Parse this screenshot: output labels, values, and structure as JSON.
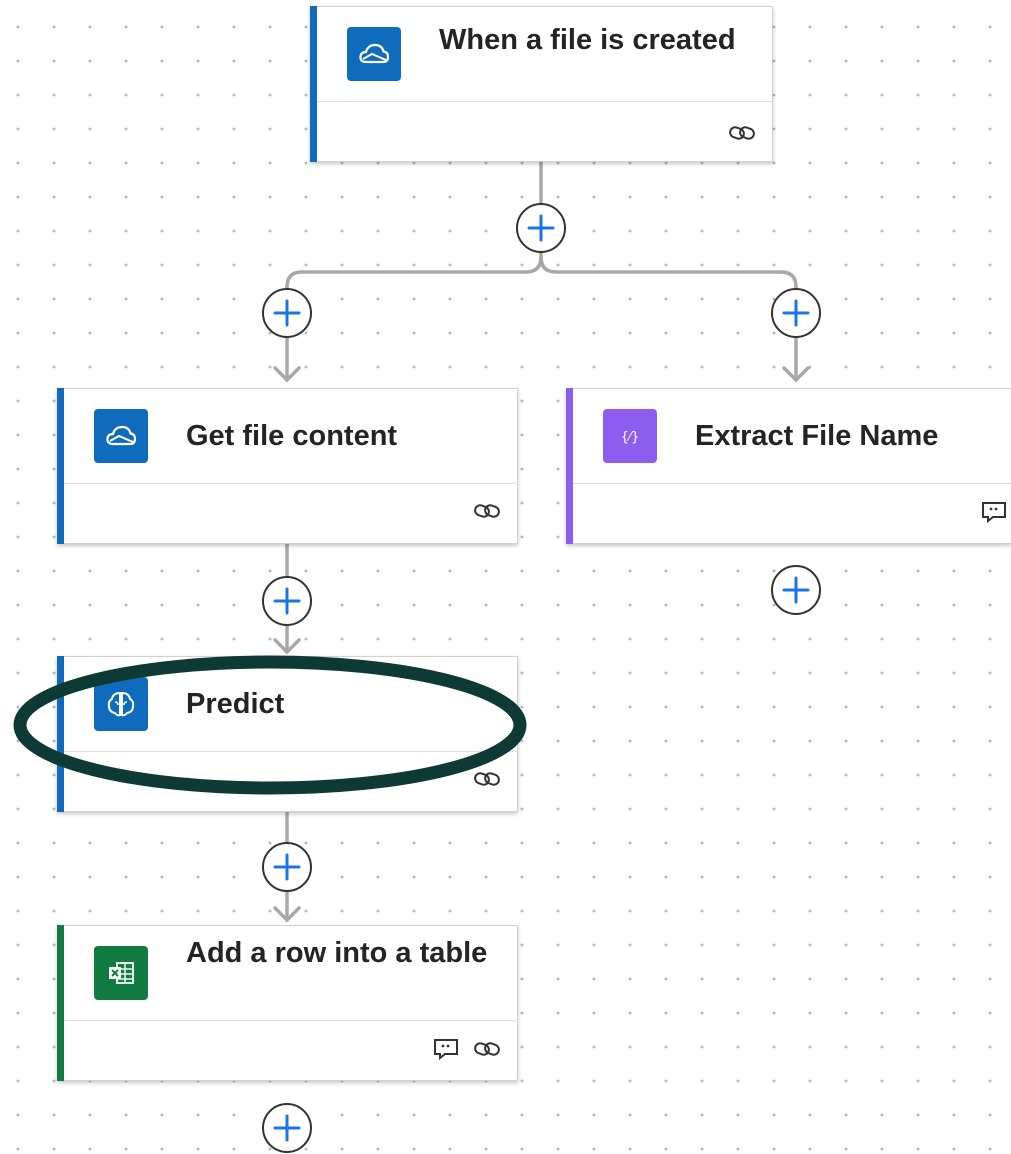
{
  "colors": {
    "onedrive_accent": "#0f6cbd",
    "data_operation_accent": "#8f5cf0",
    "ai_builder_accent": "#0f6cbd",
    "excel_accent": "#107c41",
    "plus_icon": "#1a73e8",
    "connector_line": "#a8a8a8",
    "highlight_ellipse": "#0e3a36"
  },
  "flow": {
    "trigger": {
      "title": "When a file is created",
      "icon": "onedrive-cloud-icon",
      "footer_icons": [
        "link-icon"
      ]
    },
    "steps": [
      {
        "title": "Get file content",
        "icon": "onedrive-cloud-icon",
        "footer_icons": [
          "link-icon"
        ]
      },
      {
        "title": "Extract File Name",
        "icon": "data-operation-icon",
        "footer_icons": [
          "comment-icon"
        ]
      },
      {
        "title": "Predict",
        "icon": "ai-builder-brain-icon",
        "footer_icons": [
          "link-icon"
        ],
        "highlighted": true
      },
      {
        "title": "Add a row into a table",
        "icon": "excel-icon",
        "footer_icons": [
          "comment-icon",
          "link-icon"
        ]
      }
    ]
  }
}
